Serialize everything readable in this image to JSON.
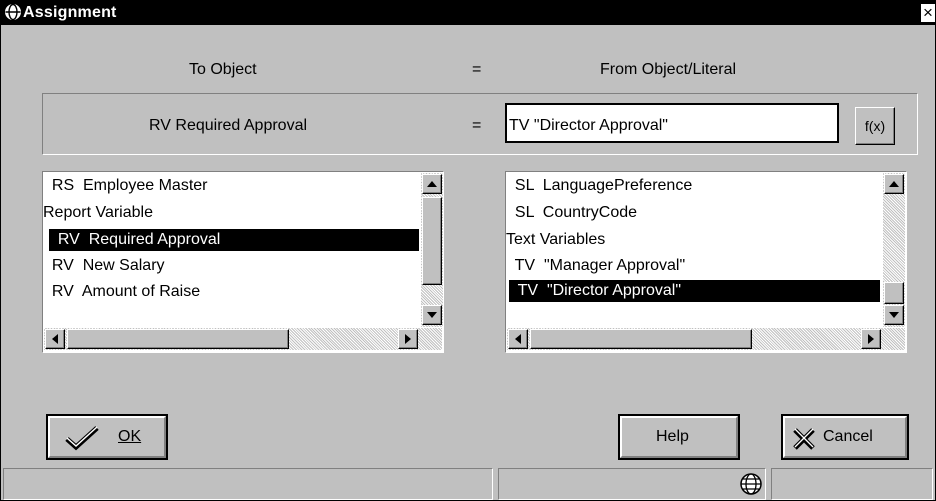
{
  "window": {
    "title": "Assignment",
    "close_glyph": "×"
  },
  "headers": {
    "to_object": "To Object",
    "equals": "=",
    "from_object": "From Object/Literal"
  },
  "assignment": {
    "to_value": "RV Required Approval",
    "equals": "=",
    "from_value": "TV \"Director Approval\"",
    "fx_label": "f(x)"
  },
  "left_list": {
    "items": [
      {
        "label": "  RS  Employee Master",
        "selected": false
      },
      {
        "label": "Report Variable",
        "selected": false
      },
      {
        "label": "  RV  Required Approval",
        "selected": true
      },
      {
        "label": "  RV  New Salary",
        "selected": false
      },
      {
        "label": "  RV  Amount of Raise",
        "selected": false
      }
    ]
  },
  "right_list": {
    "items": [
      {
        "label": "  SL  LanguagePreference",
        "selected": false
      },
      {
        "label": "  SL  CountryCode",
        "selected": false
      },
      {
        "label": "Text Variables",
        "selected": false
      },
      {
        "label": "  TV  \"Manager Approval\"",
        "selected": false
      },
      {
        "label": "  TV  \"Director Approval\"",
        "selected": true
      }
    ]
  },
  "buttons": {
    "ok": "OK",
    "help": "Help",
    "cancel": "Cancel"
  },
  "icons": {
    "title": "globe-icon",
    "ok": "checkmark-icon",
    "cancel": "x-icon",
    "status": "globe-icon"
  },
  "colors": {
    "selection": "#000000",
    "face": "#c0c0c0"
  }
}
